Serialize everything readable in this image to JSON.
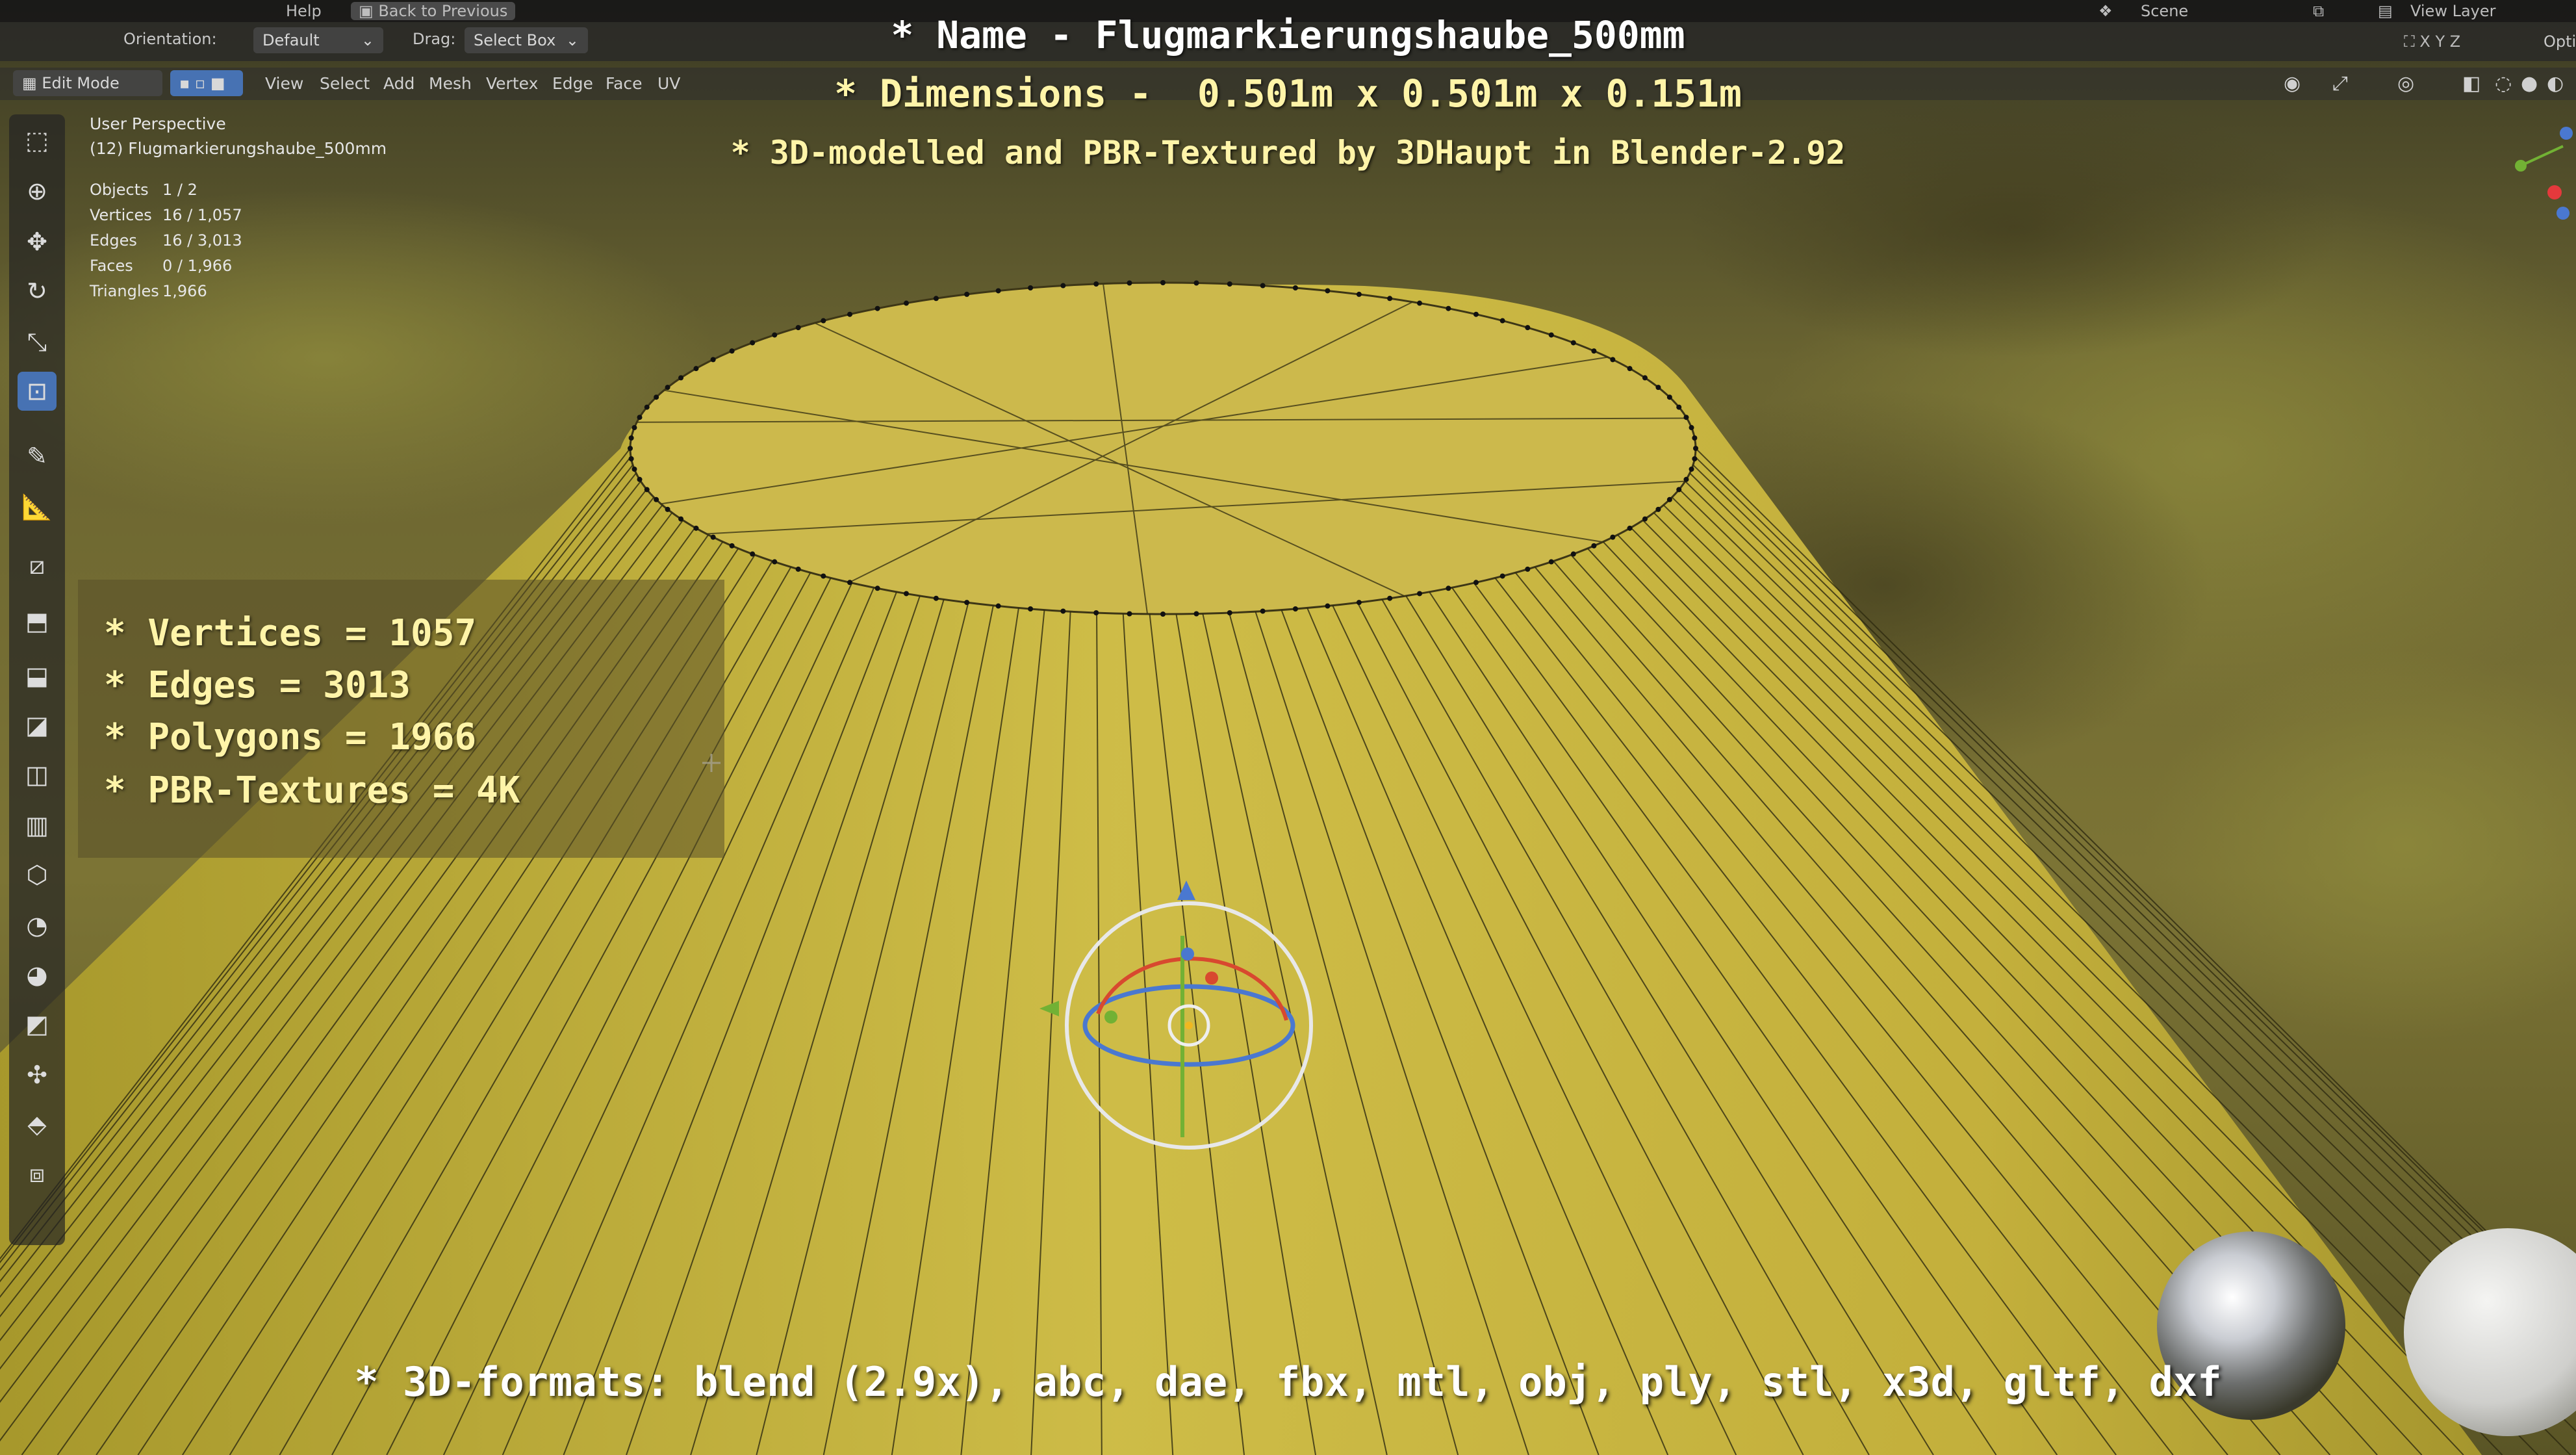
{
  "menubar": {
    "help": "Help",
    "back_to_previous": "Back to Previous",
    "scene": "Scene",
    "view_layer": "View Layer"
  },
  "header": {
    "orientation_label": "Orientation:",
    "pivot": "Default",
    "drag_label": "Drag:",
    "drag_value": "Select Box",
    "options": "Opti"
  },
  "edit_header": {
    "mode": "Edit Mode",
    "menus": [
      "View",
      "Select",
      "Add",
      "Mesh",
      "Vertex",
      "Edge",
      "Face",
      "UV"
    ]
  },
  "viewport_info": {
    "perspective": "User Perspective",
    "object_name": "(12) Flugmarkierungshaube_500mm",
    "stats": [
      {
        "label": "Objects",
        "value": "1 / 2"
      },
      {
        "label": "Vertices",
        "value": "16 / 1,057"
      },
      {
        "label": "Edges",
        "value": "16 / 3,013"
      },
      {
        "label": "Faces",
        "value": "0 / 1,966"
      },
      {
        "label": "Triangles",
        "value": "1,966"
      }
    ]
  },
  "overlay": {
    "name_line": "* Name - Flugmarkierungshaube_500mm",
    "dimensions_line": "* Dimensions -  0.501m x 0.501m x 0.151m",
    "credit_line": "* 3D-modelled and PBR-Textured by 3DHaupt in Blender-2.92",
    "info": [
      "* Vertices = 1057",
      "* Edges = 3013",
      "* Polygons = 1966",
      "* PBR-Textures = 4K"
    ],
    "formats_line": "* 3D-formats: blend (2.9x), abc, dae, fbx, mtl, obj, ply, stl, x3d, gltf, dxf"
  },
  "colors": {
    "mesh_yellow": "#c9b53a",
    "grass": "#6f6a2a",
    "active_tool": "#4772b3"
  },
  "tool_icons": [
    "select-box-icon",
    "cursor-icon",
    "move-icon",
    "rotate-icon",
    "scale-icon",
    "transform-icon",
    "annotate-icon",
    "measure-icon",
    "add-cube-icon",
    "extrude-icon",
    "inset-icon",
    "bevel-icon",
    "loop-cut-icon",
    "knife-icon",
    "poly-build-icon",
    "spin-icon",
    "smooth-icon",
    "edge-slide-icon",
    "shrink-fatten-icon",
    "shear-icon",
    "rip-icon"
  ]
}
